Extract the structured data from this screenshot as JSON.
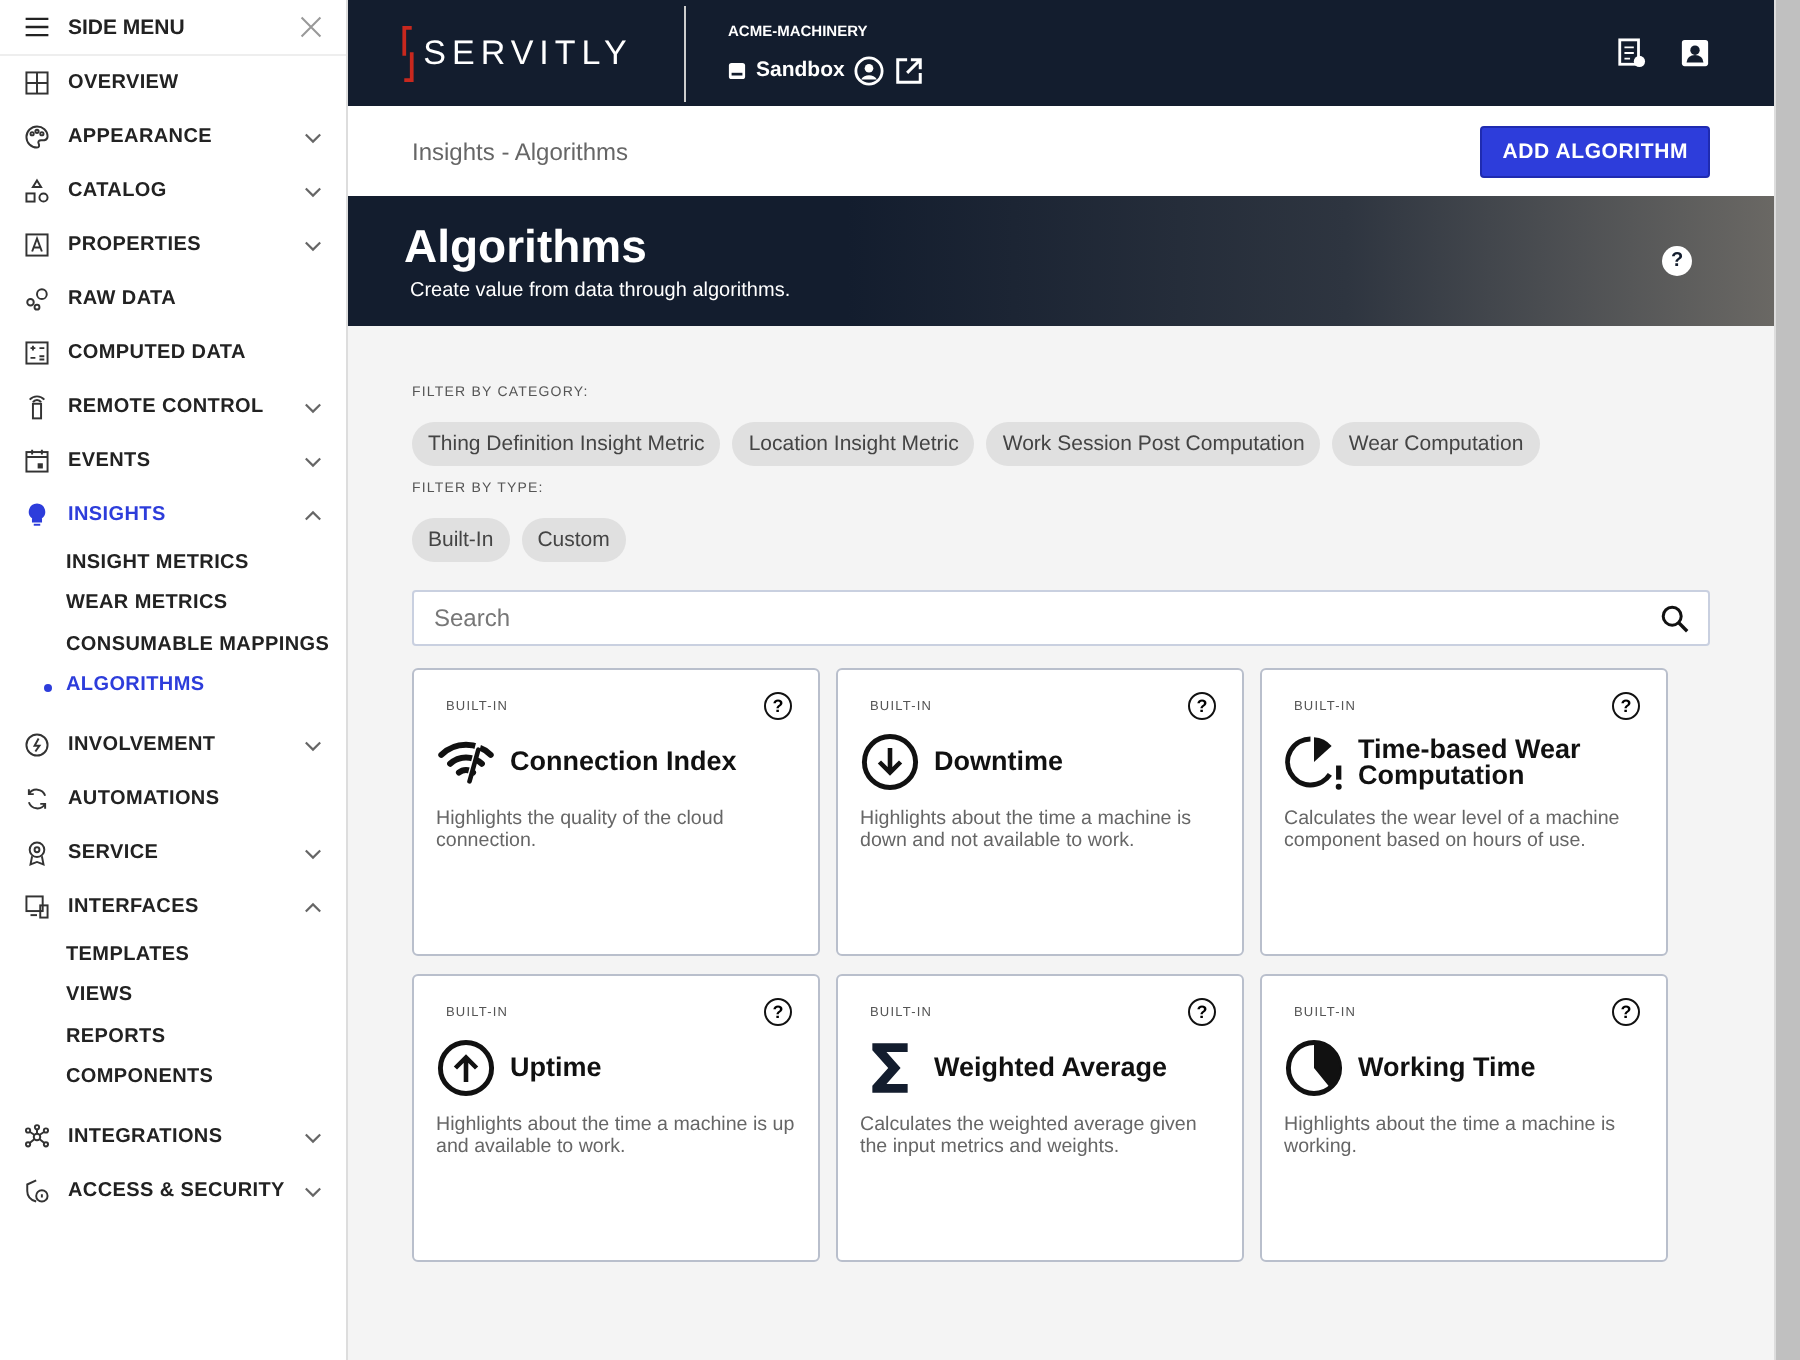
{
  "side_menu": {
    "title": "SIDE MENU",
    "items": [
      {
        "label": "OVERVIEW",
        "selected": false
      },
      {
        "label": "APPEARANCE",
        "selected": false,
        "expanded": false
      },
      {
        "label": "CATALOG",
        "selected": false,
        "expanded": false
      },
      {
        "label": "PROPERTIES",
        "selected": false,
        "expanded": false
      },
      {
        "label": "RAW DATA",
        "selected": false
      },
      {
        "label": "COMPUTED DATA",
        "selected": false
      },
      {
        "label": "REMOTE CONTROL",
        "selected": false,
        "expanded": false
      },
      {
        "label": "EVENTS",
        "selected": false,
        "expanded": false
      },
      {
        "label": "INSIGHTS",
        "selected": true,
        "expanded": true,
        "children": [
          {
            "label": "INSIGHT METRICS",
            "selected": false
          },
          {
            "label": "WEAR METRICS",
            "selected": false
          },
          {
            "label": "CONSUMABLE MAPPINGS",
            "selected": false
          },
          {
            "label": "ALGORITHMS",
            "selected": true
          }
        ]
      },
      {
        "label": "INVOLVEMENT",
        "selected": false,
        "expanded": false
      },
      {
        "label": "AUTOMATIONS",
        "selected": false
      },
      {
        "label": "SERVICE",
        "selected": false,
        "expanded": false
      },
      {
        "label": "INTERFACES",
        "selected": false,
        "expanded": true,
        "children": [
          {
            "label": "TEMPLATES",
            "selected": false
          },
          {
            "label": "VIEWS",
            "selected": false
          },
          {
            "label": "REPORTS",
            "selected": false
          },
          {
            "label": "COMPONENTS",
            "selected": false
          }
        ]
      },
      {
        "label": "INTEGRATIONS",
        "selected": false,
        "expanded": false
      },
      {
        "label": "ACCESS & SECURITY",
        "selected": false,
        "expanded": false
      }
    ]
  },
  "header": {
    "logo": "SERVITLY",
    "tenant": "ACME-MACHINERY",
    "environment": "Sandbox"
  },
  "breadcrumb": "Insights - Algorithms",
  "add_button": "ADD ALGORITHM",
  "banner": {
    "title": "Algorithms",
    "subtitle": "Create value from data through algorithms.",
    "help": "?"
  },
  "filters": [
    {
      "label": "FILTER BY CATEGORY:",
      "chips": [
        {
          "label": "Thing Definition Insight Metric",
          "selected": false
        },
        {
          "label": "Location Insight Metric",
          "selected": false
        },
        {
          "label": "Work Session Post Computation",
          "selected": false
        },
        {
          "label": "Wear Computation",
          "selected": false
        }
      ]
    },
    {
      "label": "FILTER BY TYPE:",
      "chips": [
        {
          "label": "Built-In",
          "selected": false
        },
        {
          "label": "Custom",
          "selected": false
        }
      ]
    }
  ],
  "search": {
    "placeholder": "Search"
  },
  "cards": [
    {
      "tag": "BUILT-IN",
      "help": "?",
      "title": "Connection Index",
      "description": "Highlights the quality of the cloud connection."
    },
    {
      "tag": "BUILT-IN",
      "help": "?",
      "title": "Downtime",
      "description": "Highlights about the time a machine is down and not available to work."
    },
    {
      "tag": "BUILT-IN",
      "help": "?",
      "title": "Time-based Wear Computation",
      "description": "Calculates the wear level of a machine component based on hours of use."
    },
    {
      "tag": "BUILT-IN",
      "help": "?",
      "title": "Uptime",
      "description": "Highlights about the time a machine is up and available to work."
    },
    {
      "tag": "BUILT-IN",
      "help": "?",
      "title": "Weighted Average",
      "description": "Calculates the weighted average given the input metrics and weights."
    },
    {
      "tag": "BUILT-IN",
      "help": "?",
      "title": "Working Time",
      "description": "Highlights about the time a machine is working."
    }
  ]
}
